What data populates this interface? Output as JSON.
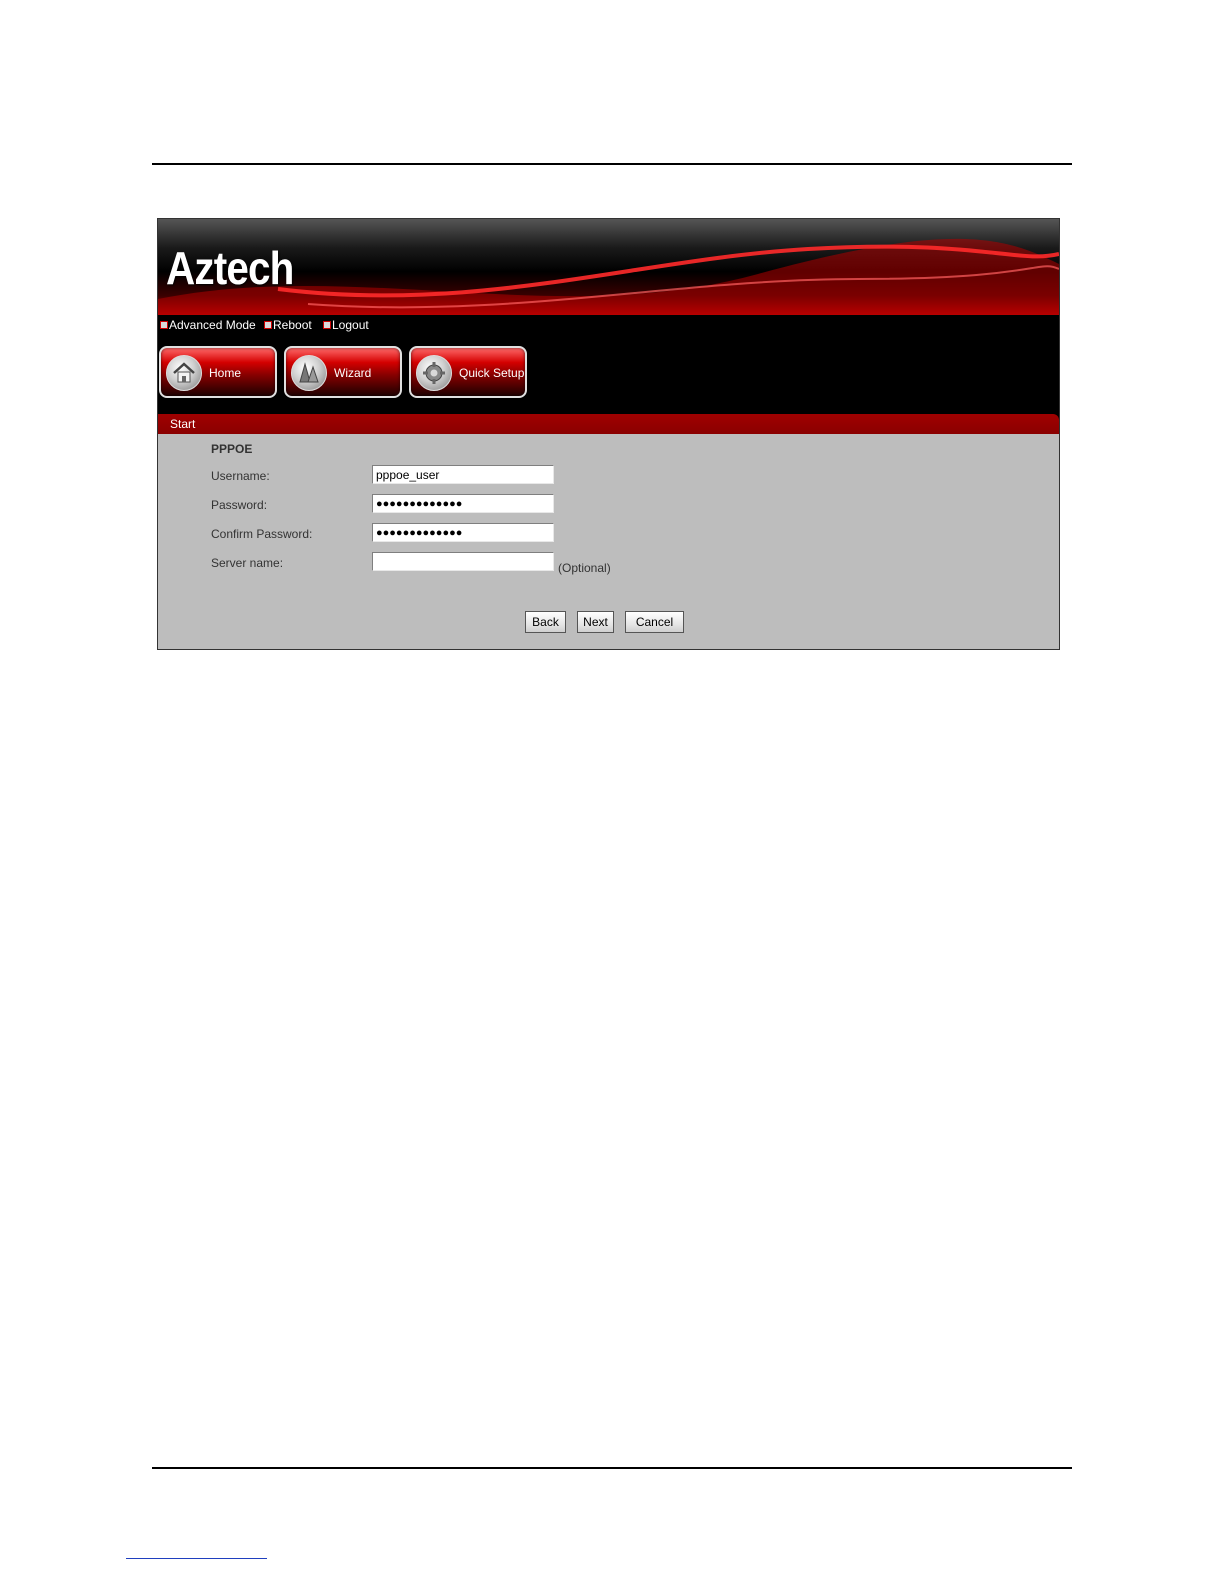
{
  "brand": {
    "logo_text": "Aztech"
  },
  "top_links": [
    {
      "label": "Advanced Mode"
    },
    {
      "label": "Reboot"
    },
    {
      "label": "Logout"
    }
  ],
  "nav": [
    {
      "label": "Home",
      "icon": "home-icon"
    },
    {
      "label": "Wizard",
      "icon": "wizard-icon"
    },
    {
      "label": "Quick Setup",
      "icon": "quick-setup-icon"
    }
  ],
  "tab": {
    "title": "Start"
  },
  "form": {
    "section_title": "PPPOE",
    "username": {
      "label": "Username:",
      "value": "pppoe_user"
    },
    "password": {
      "label": "Password:",
      "value": "●●●●●●●●●●●●●"
    },
    "confirm_password": {
      "label": "Confirm Password:",
      "value": "●●●●●●●●●●●●●"
    },
    "server_name": {
      "label": "Server name:",
      "value": "",
      "hint": "(Optional)"
    }
  },
  "buttons": {
    "back": "Back",
    "next": "Next",
    "cancel": "Cancel"
  },
  "colors": {
    "accent": "#c00000",
    "tab": "#8a0000",
    "panel": "#bdbdbd"
  }
}
